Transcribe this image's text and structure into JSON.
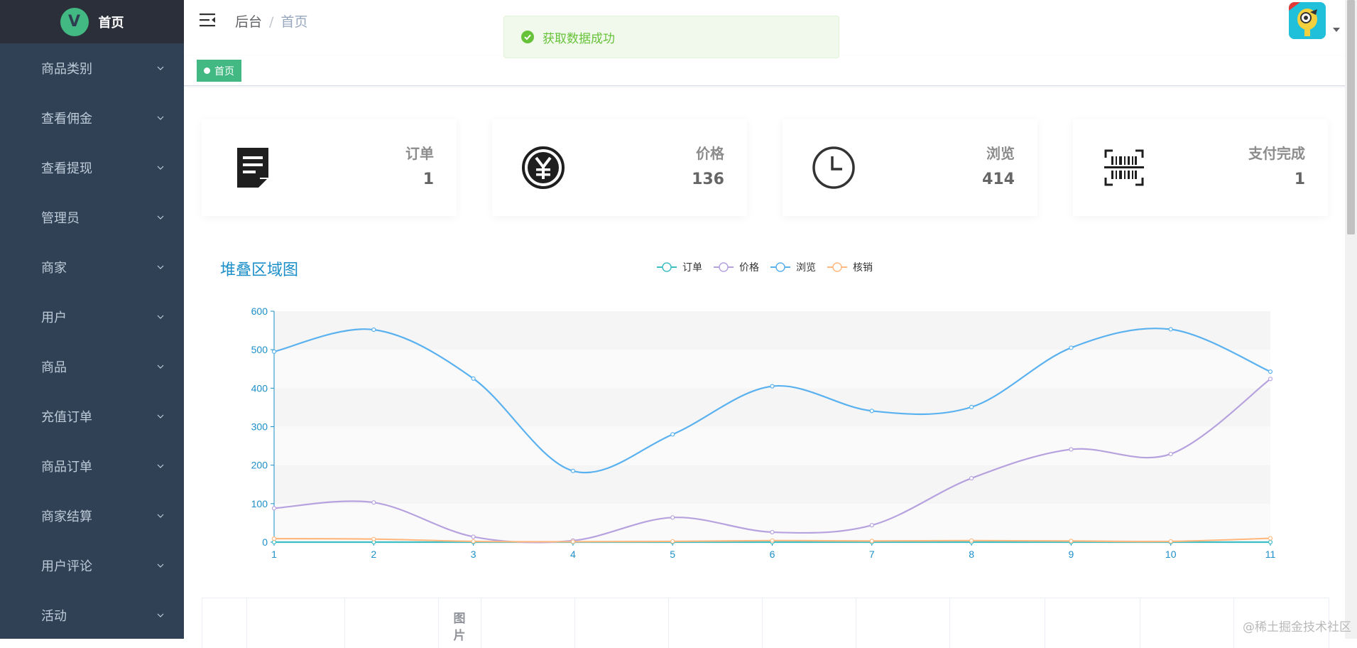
{
  "app": {
    "logo_letter": "V",
    "title": "首页"
  },
  "sidebar": {
    "items": [
      {
        "label": "商品类别",
        "name": "sidebar-item-product-category"
      },
      {
        "label": "查看佣金",
        "name": "sidebar-item-commission"
      },
      {
        "label": "查看提现",
        "name": "sidebar-item-withdrawal"
      },
      {
        "label": "管理员",
        "name": "sidebar-item-admin"
      },
      {
        "label": "商家",
        "name": "sidebar-item-merchant"
      },
      {
        "label": "用户",
        "name": "sidebar-item-user"
      },
      {
        "label": "商品",
        "name": "sidebar-item-product"
      },
      {
        "label": "充值订单",
        "name": "sidebar-item-recharge-order"
      },
      {
        "label": "商品订单",
        "name": "sidebar-item-product-order"
      },
      {
        "label": "商家结算",
        "name": "sidebar-item-merchant-settlement"
      },
      {
        "label": "用户评论",
        "name": "sidebar-item-user-review"
      },
      {
        "label": "活动",
        "name": "sidebar-item-activity"
      }
    ]
  },
  "header": {
    "breadcrumb": {
      "root": "后台",
      "separator": "/",
      "current": "首页"
    }
  },
  "tags": {
    "active": "首页"
  },
  "toast": {
    "message": "获取数据成功",
    "color": "#67c23a"
  },
  "stats": [
    {
      "label": "订单",
      "value": "1",
      "icon": "order-document-icon"
    },
    {
      "label": "价格",
      "value": "136",
      "icon": "yen-icon"
    },
    {
      "label": "浏览",
      "value": "414",
      "icon": "clock-icon"
    },
    {
      "label": "支付完成",
      "value": "1",
      "icon": "barcode-scan-icon"
    }
  ],
  "chart_data": {
    "type": "line",
    "title": "堆叠区域图",
    "smooth": true,
    "categories": [
      "1",
      "2",
      "3",
      "4",
      "5",
      "6",
      "7",
      "8",
      "9",
      "10",
      "11"
    ],
    "ylim": [
      0,
      600
    ],
    "yticks": [
      0,
      100,
      200,
      300,
      400,
      500,
      600
    ],
    "legend_position": "top-center",
    "series": [
      {
        "name": "订单",
        "color": "#3ebfc6",
        "values": [
          0,
          0,
          0,
          0,
          0,
          0,
          0,
          0,
          0,
          0,
          0
        ]
      },
      {
        "name": "价格",
        "color": "#b6a2de",
        "values": [
          88,
          103,
          14,
          4,
          64,
          26,
          44,
          166,
          241,
          229,
          424
        ]
      },
      {
        "name": "浏览",
        "color": "#5ab1ef",
        "values": [
          495,
          552,
          425,
          185,
          280,
          405,
          341,
          351,
          505,
          553,
          443
        ]
      },
      {
        "name": "核销",
        "color": "#ffb980",
        "values": [
          9,
          8,
          2,
          1,
          2,
          4,
          3,
          4,
          3,
          2,
          10
        ]
      }
    ],
    "grid": "alternating-bands"
  },
  "table": {
    "header_partial": "图片"
  },
  "watermark": "@稀土掘金技术社区"
}
